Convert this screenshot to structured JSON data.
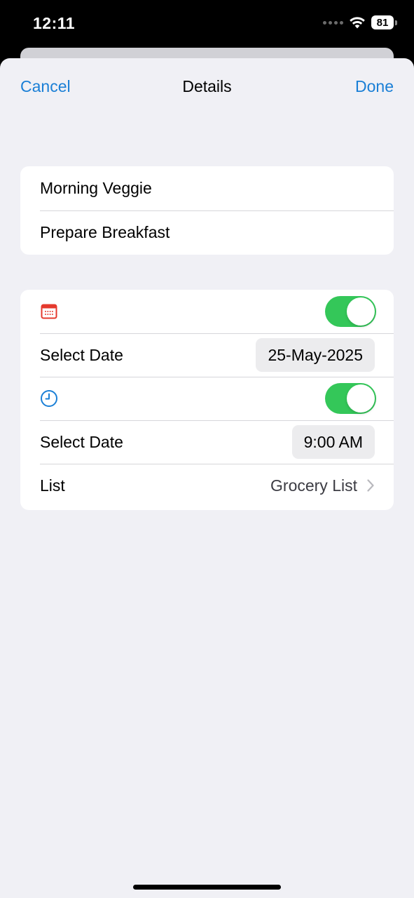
{
  "status_bar": {
    "time": "12:11",
    "battery": "81"
  },
  "nav": {
    "cancel_label": "Cancel",
    "title": "Details",
    "done_label": "Done"
  },
  "task": {
    "title": "Morning Veggie",
    "notes": "Prepare Breakfast"
  },
  "schedule": {
    "date_icon": "calendar-icon",
    "date_enabled": true,
    "date_label": "Select Date",
    "date_value": "25-May-2025",
    "time_icon": "clock-icon",
    "time_enabled": true,
    "time_label": "Select Date",
    "time_value": "9:00 AM",
    "list_label": "List",
    "list_value": "Grocery List"
  },
  "colors": {
    "accent": "#1a7fd6",
    "toggle_on": "#34c759",
    "calendar_icon": "#e5392d",
    "background": "#f0f0f5"
  }
}
